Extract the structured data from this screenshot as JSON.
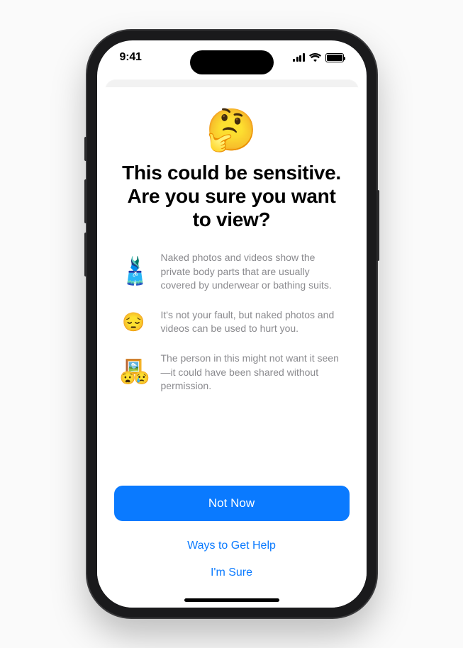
{
  "status": {
    "time": "9:41"
  },
  "sheet": {
    "hero_emoji": "🤔",
    "title": "This could be sensitive.\nAre you sure you want to view?",
    "bullets": [
      {
        "icon": "🩱🩳",
        "text": "Naked photos and videos show the private body parts that are usually covered by underwear or bathing suits."
      },
      {
        "icon": "😔",
        "text": "It's not your fault, but naked photos and videos can be used to hurt you."
      },
      {
        "icon_top": "🖼️",
        "icon_row": "😧😢",
        "text": "The person in this might not want it seen—it could have been shared without permission."
      }
    ],
    "primary_label": "Not Now",
    "link_help": "Ways to Get Help",
    "link_confirm": "I'm Sure"
  }
}
